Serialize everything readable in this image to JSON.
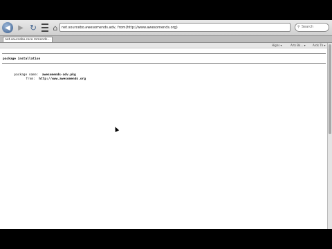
{
  "toolbar": {
    "back_icon": "back-arrow-icon",
    "url": "net.sourcebo.awesomends.adv, from(http://www.awesomends.org)",
    "search_placeholder": "Search"
  },
  "tab": {
    "title": "net.sourcebo.reco mmends..."
  },
  "findbar": {
    "item1": "Highs ▾",
    "item2": "Arts Bk… ▾",
    "item3": "Ards Th ▾"
  },
  "page": {
    "heading": "package installation",
    "name_label": "package name:",
    "name_value": "awesomends-adv.pkg",
    "from_label": "from:",
    "from_value": "http://www.awesomends.org"
  }
}
